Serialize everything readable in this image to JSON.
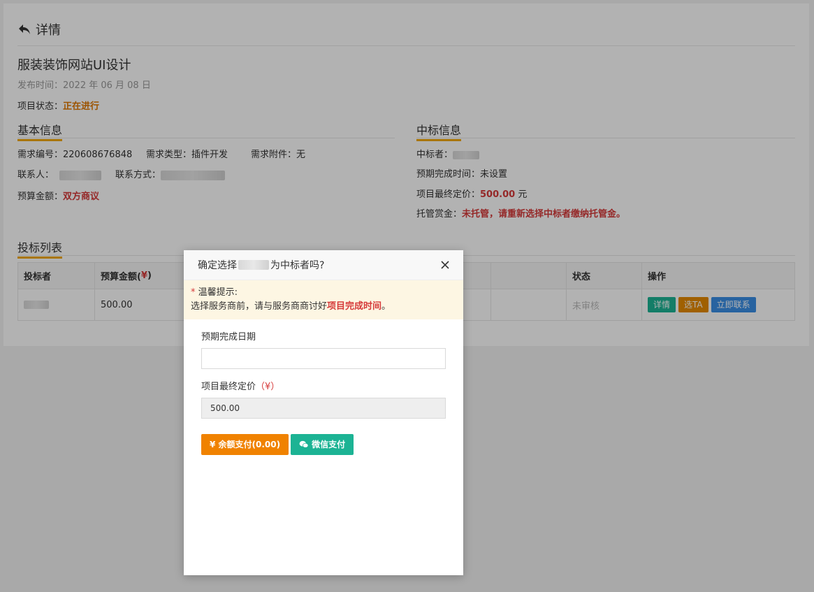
{
  "header": {
    "back_label": "详情"
  },
  "project": {
    "title": "服装装饰网站UI设计",
    "publish_time": "发布时间：2022 年 06 月 08 日",
    "status_label": "项目状态：",
    "status_value": "正在进行"
  },
  "basic_info": {
    "heading": "基本信息",
    "demand_no_label": "需求编号：",
    "demand_no": "220608676848",
    "demand_type_label": "需求类型：",
    "demand_type": "插件开发",
    "attachment_label": "需求附件：",
    "attachment": "无",
    "contact_label": "联系人：",
    "contact_method_label": "联系方式：",
    "budget_label": "预算金额：",
    "budget_value": "双方商议"
  },
  "winner_info": {
    "heading": "中标信息",
    "winner_label": "中标者：",
    "expected_time_label": "预期完成时间：",
    "expected_time": "未设置",
    "final_price_label": "项目最终定价：",
    "final_price": "500.00",
    "final_price_unit": " 元",
    "escrow_label": "托管赏金：",
    "escrow_value": "未托管，请重新选择中标者缴纳托管金。"
  },
  "bid_list": {
    "heading": "投标列表",
    "columns": [
      "投标者",
      "预算金额(",
      "¥",
      ")",
      "状态",
      "操作"
    ],
    "rows": [
      {
        "budget": "500.00",
        "status": "未审核",
        "actions": [
          "详情",
          "选TA",
          "立即联系"
        ]
      }
    ]
  },
  "colors": {
    "orange": "#e07800",
    "red": "#d63a3a",
    "teal": "#1cb394",
    "action_orange": "#e58a00",
    "blue": "#3a8ee6"
  },
  "modal": {
    "title_prefix": "确定选择",
    "title_suffix": "为中标者吗?",
    "tip_star": "*",
    "tip_title": " 温馨提示:",
    "tip_text": "选择服务商前，请与服务商商讨好",
    "tip_highlight": "项目完成时间",
    "tip_end": "。",
    "date_label": "预期完成日期",
    "date_value": "",
    "price_label": "项目最终定价",
    "price_unit": "（¥）",
    "price_value": "500.00",
    "balance_pay": "¥ 余额支付(0.00)",
    "wechat_pay": "微信支付"
  }
}
